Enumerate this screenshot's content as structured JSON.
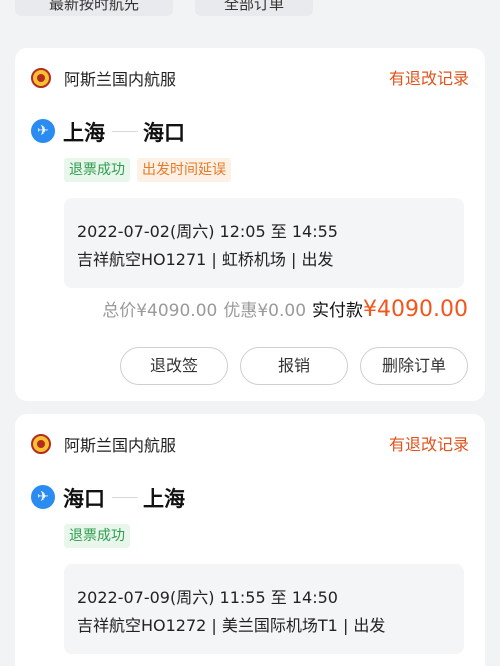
{
  "top_chips": [
    "最新按时航先",
    "全部订单"
  ],
  "orders": [
    {
      "airline": "阿斯兰国内航服",
      "change_link": "有退改记录",
      "from": "上海",
      "to": "海口",
      "badges": [
        "退票成功",
        "出发时间延误"
      ],
      "detail_time": "2022-07-02(周六) 12:05 至 14:55",
      "detail_flight": "吉祥航空HO1271 | 虹桥机场 | 出发",
      "price_total": "总价¥4090.00",
      "price_discount": "优惠¥0.00",
      "price_label": "实付款",
      "price_actual": "¥4090.00",
      "buttons": [
        "退改签",
        "报销",
        "删除订单"
      ]
    },
    {
      "airline": "阿斯兰国内航服",
      "change_link": "有退改记录",
      "from": "海口",
      "to": "上海",
      "badges": [
        "退票成功"
      ],
      "detail_time": "2022-07-09(周六) 11:55 至 14:50",
      "detail_flight": "吉祥航空HO1272 | 美兰国际机场T1 | 出发"
    }
  ],
  "icons": {
    "airline_logo": "airline-logo-icon",
    "plane": "plane-icon"
  },
  "colors": {
    "accent": "#e0531b",
    "price": "#f2561d",
    "success": "#2f9e4f",
    "warning": "#e27b2a",
    "plane": "#2a8cf0"
  }
}
